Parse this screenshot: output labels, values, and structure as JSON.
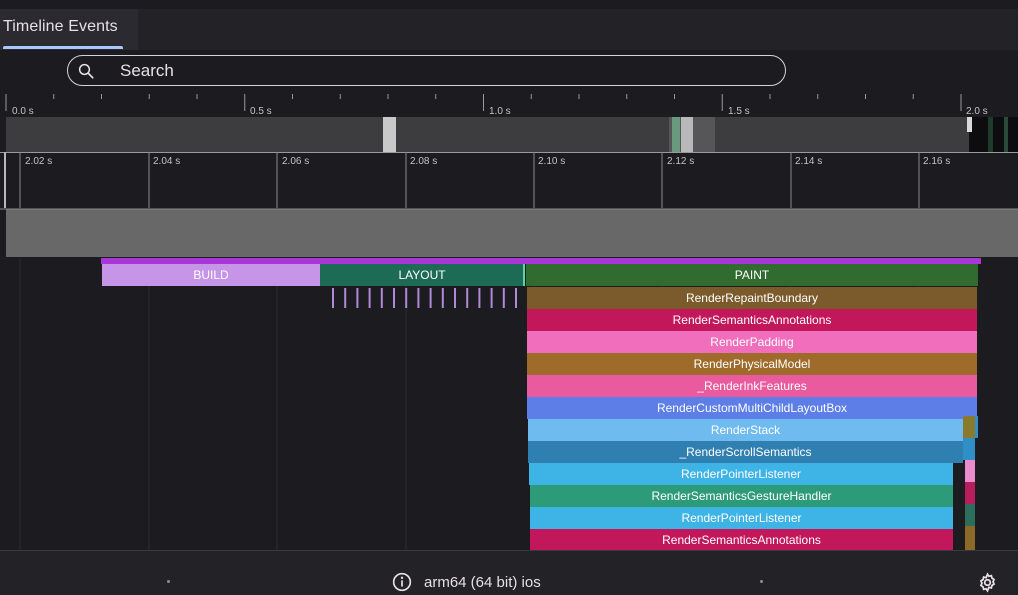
{
  "tabs": [
    {
      "label": "Timeline Events",
      "selected": true
    }
  ],
  "search": {
    "placeholder": "Search",
    "value": ""
  },
  "overview_ruler": {
    "unit": "s",
    "major_labels": [
      "0.0 s",
      "0.5 s",
      "1.0 s",
      "1.5 s",
      "2.0 s"
    ]
  },
  "zoom_ruler": {
    "labels": [
      "2.02 s",
      "2.04 s",
      "2.06 s",
      "2.08 s",
      "2.10 s",
      "2.12 s",
      "2.14 s",
      "2.16 s"
    ]
  },
  "flame_events": [
    {
      "label": "BUILD",
      "color": "#c795e8",
      "text_color": "#3b2a45"
    },
    {
      "label": "LAYOUT",
      "color": "#1e6b55",
      "text_color": "#ffffff"
    },
    {
      "label": "PAINT",
      "color": "#326b30",
      "text_color": "#ffffff"
    },
    {
      "label": "RenderRepaintBoundary",
      "color": "#7b5a2b"
    },
    {
      "label": "RenderSemanticsAnnotations",
      "color": "#c2185b"
    },
    {
      "label": "RenderPadding",
      "color": "#f06ebc"
    },
    {
      "label": "RenderPhysicalModel",
      "color": "#9e6b2b"
    },
    {
      "label": "_RenderInkFeatures",
      "color": "#ea5a9e"
    },
    {
      "label": "RenderCustomMultiChildLayoutBox",
      "color": "#5c7ee6"
    },
    {
      "label": "RenderStack",
      "color": "#6fbbf0"
    },
    {
      "label": "_RenderScrollSemantics",
      "color": "#2f7fb0"
    },
    {
      "label": "RenderPointerListener",
      "color": "#3eb4e6"
    },
    {
      "label": "RenderSemanticsGestureHandler",
      "color": "#2e9b78"
    },
    {
      "label": "RenderPointerListener",
      "color": "#3eb4e6"
    },
    {
      "label": "RenderSemanticsAnnotations",
      "color": "#c2185b"
    }
  ],
  "footer": {
    "device": "arm64 (64 bit) ios",
    "icons": [
      "info-icon",
      "settings-gear-icon"
    ]
  }
}
